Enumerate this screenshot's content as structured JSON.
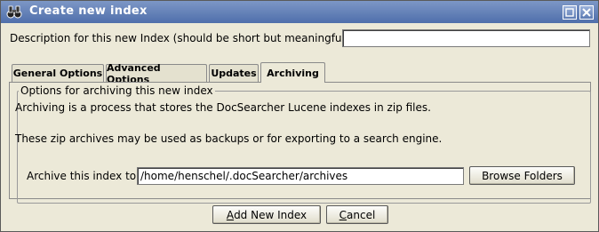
{
  "window": {
    "title": "Create new index",
    "maximize_glyph": "□",
    "close_glyph": "✕",
    "app_icon": "binoculars-icon"
  },
  "description": {
    "label": "Description for this new Index (should be short but meaningful):",
    "value": ""
  },
  "tabs": [
    {
      "label": "General Options",
      "active": false
    },
    {
      "label": "Advanced Options",
      "active": false
    },
    {
      "label": "Updates",
      "active": false
    },
    {
      "label": "Archiving",
      "active": true
    }
  ],
  "archiving": {
    "group_title": "Options for archiving this new index",
    "info_line_1": "Archiving is a process that stores the DocSearcher Lucene indexes in zip files.",
    "info_line_2": "These zip archives may be used as backups or for exporting to a search engine.",
    "path_label": "Archive this index to:",
    "path_value": "/home/henschel/.docSearcher/archives",
    "browse_label": "Browse Folders"
  },
  "buttons": {
    "add_label_mnemonic": "A",
    "add_label_rest": "dd New Index",
    "cancel_label_mnemonic": "C",
    "cancel_label_rest": "ancel"
  },
  "colors": {
    "titlebar": "#4f6fab",
    "window_bg": "#ece9d8"
  }
}
